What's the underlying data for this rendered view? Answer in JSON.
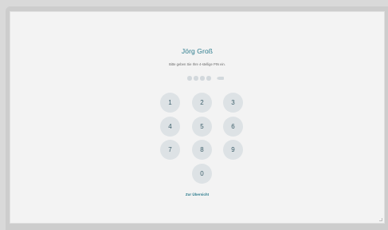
{
  "user": {
    "name": "Jörg Groß"
  },
  "prompt": {
    "text": "Bitte geben Sie Ihre 4-stellige PIN ein."
  },
  "pin": {
    "length": 4,
    "entered": 0
  },
  "keypad": {
    "k1": "1",
    "k2": "2",
    "k3": "3",
    "k4": "4",
    "k5": "5",
    "k6": "6",
    "k7": "7",
    "k8": "8",
    "k9": "9",
    "k0": "0"
  },
  "links": {
    "overview": "Zur Übersicht"
  },
  "colors": {
    "accent": "#2a7a8c",
    "key_background": "#dde2e5",
    "key_text": "#3d5f6b",
    "pin_dot": "#d2d8dc",
    "screen_background": "#f3f3f3"
  }
}
